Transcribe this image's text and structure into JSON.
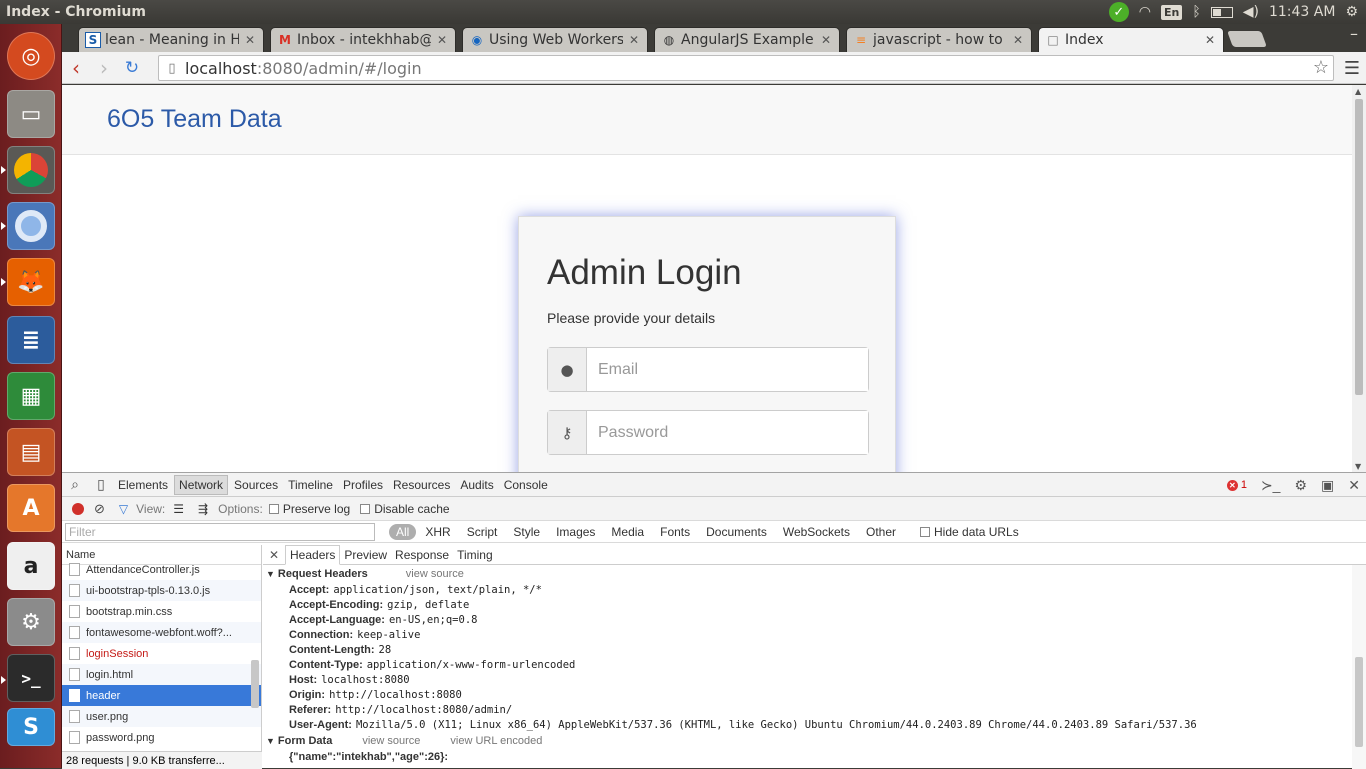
{
  "system": {
    "window_title": "Index - Chromium",
    "keyboard_layout": "En",
    "clock": "11:43 AM"
  },
  "tabs": [
    {
      "label": "lean - Meaning in Hi",
      "favicon": "S"
    },
    {
      "label": "Inbox - intekhhab@g",
      "favicon": "M"
    },
    {
      "label": "Using Web Workers",
      "favicon": "◉"
    },
    {
      "label": "AngularJS Example",
      "favicon": "◍"
    },
    {
      "label": "javascript - how to g",
      "favicon": "≡"
    },
    {
      "label": "Index",
      "favicon": "□"
    }
  ],
  "omnibox": {
    "url_host": "localhost",
    "url_rest": ":8080/admin/#/login"
  },
  "page": {
    "brand": "6O5 Team Data",
    "login": {
      "heading": "Admin Login",
      "subtitle": "Please provide your details",
      "email_placeholder": "Email",
      "password_placeholder": "Password"
    }
  },
  "devtools": {
    "panels": [
      "Elements",
      "Network",
      "Sources",
      "Timeline",
      "Profiles",
      "Resources",
      "Audits",
      "Console"
    ],
    "selected_panel": "Network",
    "error_count": "1",
    "toolbar": {
      "view_label": "View:",
      "options_label": "Options:",
      "preserve_log": "Preserve log",
      "disable_cache": "Disable cache"
    },
    "filter": {
      "placeholder": "Filter",
      "types": [
        "All",
        "XHR",
        "Script",
        "Style",
        "Images",
        "Media",
        "Fonts",
        "Documents",
        "WebSockets",
        "Other"
      ],
      "hide_data_urls": "Hide data URLs"
    },
    "requests": {
      "column_name": "Name",
      "items": [
        {
          "name": "AttendanceController.js",
          "error": false
        },
        {
          "name": "ui-bootstrap-tpls-0.13.0.js",
          "error": false
        },
        {
          "name": "bootstrap.min.css",
          "error": false
        },
        {
          "name": "fontawesome-webfont.woff?...",
          "error": false
        },
        {
          "name": "loginSession",
          "error": true
        },
        {
          "name": "login.html",
          "error": false
        },
        {
          "name": "header",
          "error": false
        },
        {
          "name": "user.png",
          "error": false
        },
        {
          "name": "password.png",
          "error": false
        }
      ],
      "selected": "header",
      "summary": "28 requests  |  9.0 KB transferre..."
    },
    "detail": {
      "tabs": [
        "Headers",
        "Preview",
        "Response",
        "Timing"
      ],
      "request_headers_title": "Request Headers",
      "view_source": "view source",
      "view_url_encoded": "view URL encoded",
      "headers": [
        {
          "key": "Accept:",
          "value": "application/json, text/plain, */*"
        },
        {
          "key": "Accept-Encoding:",
          "value": "gzip, deflate"
        },
        {
          "key": "Accept-Language:",
          "value": "en-US,en;q=0.8"
        },
        {
          "key": "Connection:",
          "value": "keep-alive"
        },
        {
          "key": "Content-Length:",
          "value": "28"
        },
        {
          "key": "Content-Type:",
          "value": "application/x-www-form-urlencoded"
        },
        {
          "key": "Host:",
          "value": "localhost:8080"
        },
        {
          "key": "Origin:",
          "value": "http://localhost:8080"
        },
        {
          "key": "Referer:",
          "value": "http://localhost:8080/admin/"
        },
        {
          "key": "User-Agent:",
          "value": "Mozilla/5.0 (X11; Linux x86_64) AppleWebKit/537.36 (KHTML, like Gecko) Ubuntu Chromium/44.0.2403.89 Chrome/44.0.2403.89 Safari/537.36"
        }
      ],
      "form_data_title": "Form Data",
      "form_data_value": "{\"name\":\"intekhab\",\"age\":26}:"
    }
  }
}
